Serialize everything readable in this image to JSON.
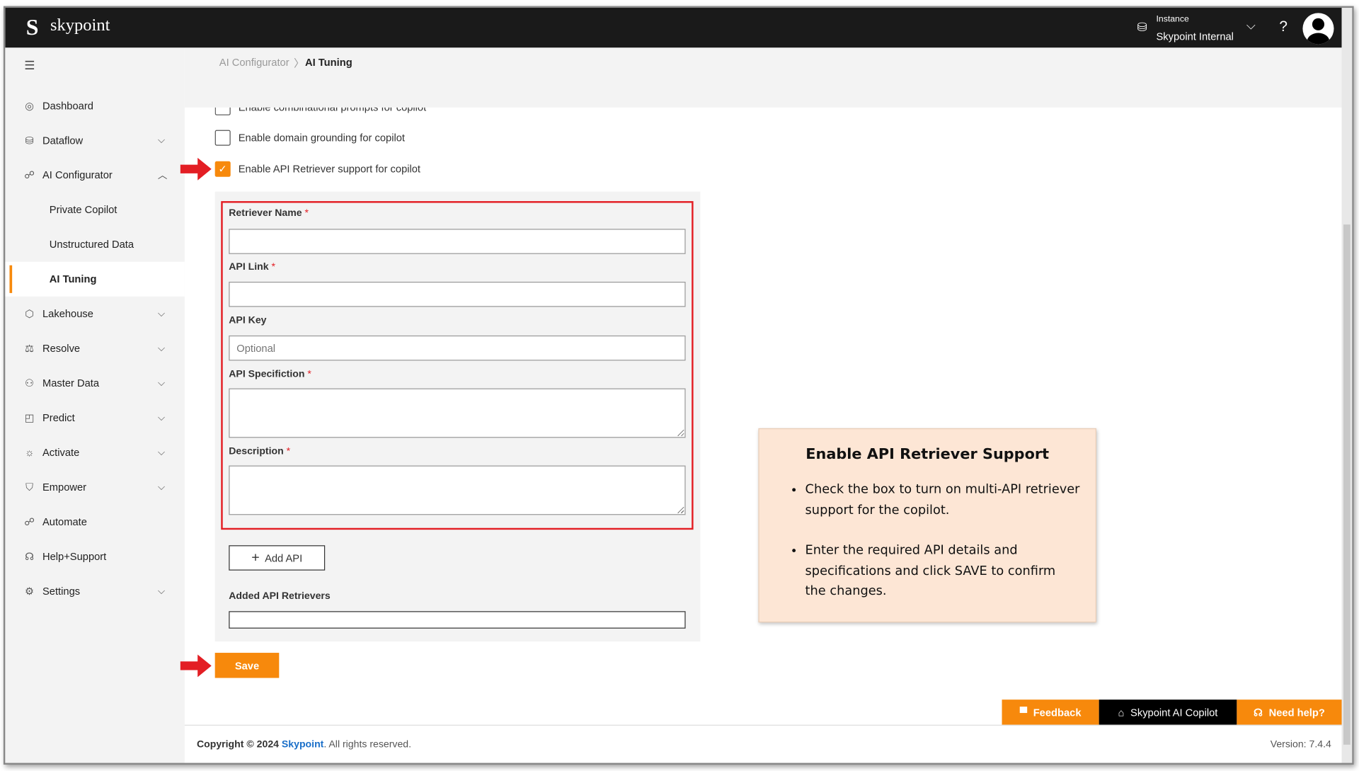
{
  "header": {
    "logo_letter": "S",
    "brand": "skypoint",
    "instance_label": "Instance",
    "instance_value": "Skypoint Internal",
    "help": "?"
  },
  "sidebar": {
    "items": [
      {
        "label": "Dashboard",
        "icon": "dashboard-icon",
        "glyph": "◎"
      },
      {
        "label": "Dataflow",
        "icon": "dataflow-icon",
        "glyph": "⛁",
        "chevron": "⌵"
      },
      {
        "label": "AI Configurator",
        "icon": "ai-configurator-icon",
        "glyph": "☍",
        "chevron": "︿"
      },
      {
        "label": "Private Copilot"
      },
      {
        "label": "Unstructured Data"
      },
      {
        "label": "AI Tuning"
      },
      {
        "label": "Lakehouse",
        "icon": "lakehouse-icon",
        "glyph": "⬡",
        "chevron": "⌵"
      },
      {
        "label": "Resolve",
        "icon": "resolve-icon",
        "glyph": "⚖",
        "chevron": "⌵"
      },
      {
        "label": "Master Data",
        "icon": "master-data-icon",
        "glyph": "⚇",
        "chevron": "⌵"
      },
      {
        "label": "Predict",
        "icon": "predict-icon",
        "glyph": "◰",
        "chevron": "⌵"
      },
      {
        "label": "Activate",
        "icon": "activate-icon",
        "glyph": "☼",
        "chevron": "⌵"
      },
      {
        "label": "Empower",
        "icon": "empower-icon",
        "glyph": "⛉",
        "chevron": "⌵"
      },
      {
        "label": "Automate",
        "icon": "automate-icon",
        "glyph": "☍"
      },
      {
        "label": "Help+Support",
        "icon": "headset-icon",
        "glyph": "☊"
      },
      {
        "label": "Settings",
        "icon": "gear-icon",
        "glyph": "⚙",
        "chevron": "⌵"
      }
    ]
  },
  "breadcrumb": {
    "parent": "AI Configurator",
    "current": "AI Tuning"
  },
  "checkboxes": [
    {
      "label": "Enable combinational prompts for copilot",
      "checked": false
    },
    {
      "label": "Enable domain grounding for copilot",
      "checked": false
    },
    {
      "label": "Enable API Retriever support for copilot",
      "checked": true
    }
  ],
  "form": {
    "retriever_name": {
      "label": "Retriever Name",
      "required": "*",
      "value": ""
    },
    "api_link": {
      "label": "API Link",
      "required": "*",
      "value": ""
    },
    "api_key": {
      "label": "API Key",
      "placeholder": "Optional"
    },
    "api_spec": {
      "label": "API Specifiction",
      "required": "*"
    },
    "description": {
      "label": "Description",
      "required": "*"
    },
    "add_api": "Add API",
    "added_label": "Added API Retrievers",
    "save": "Save"
  },
  "callout": {
    "title": "Enable API Retriever Support",
    "bullets": [
      "Check the box to turn on multi-API retriever support for the copilot.",
      "Enter the required API details and specifications and click SAVE to confirm the changes."
    ]
  },
  "floating": {
    "feedback": "Feedback",
    "copilot": "Skypoint AI Copilot",
    "help": "Need help?"
  },
  "footer": {
    "copyright": "Copyright © 2024",
    "brand": "Skypoint",
    "rights": ". All rights reserved.",
    "version": "Version: 7.4.4"
  },
  "colors": {
    "accent": "#f7890c",
    "highlight": "#e31e24",
    "callout_bg": "#fde6d5",
    "topbar": "#1a1a1a"
  }
}
